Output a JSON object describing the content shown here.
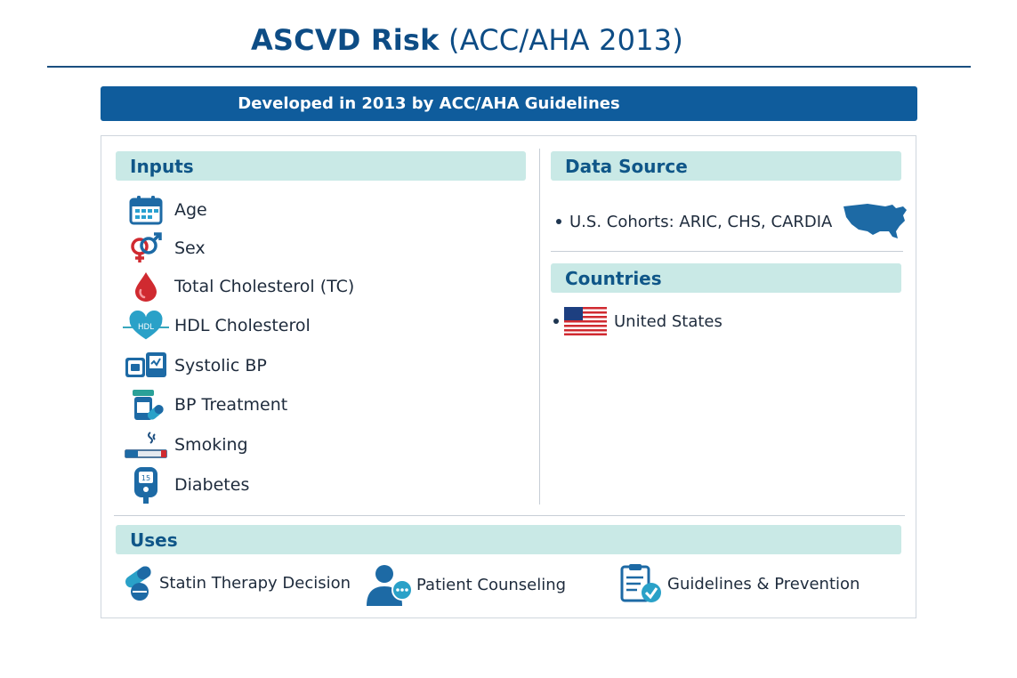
{
  "title": {
    "bold": "ASCVD Risk",
    "light": "(ACC/AHA 2013)"
  },
  "banner": "Developed in 2013 by ACC/AHA Guidelines",
  "inputs": {
    "heading": "Inputs",
    "items": [
      {
        "label": "Age",
        "icon": "calendar-icon"
      },
      {
        "label": "Sex",
        "icon": "gender-icon"
      },
      {
        "label": "Total Cholesterol (TC)",
        "icon": "blood-drop-icon"
      },
      {
        "label": "HDL Cholesterol",
        "icon": "heart-hdl-icon",
        "icon_text": "HDL"
      },
      {
        "label": "Systolic BP",
        "icon": "bp-monitor-icon"
      },
      {
        "label": "BP Treatment",
        "icon": "pill-bottle-icon"
      },
      {
        "label": "Smoking",
        "icon": "cigarette-icon"
      },
      {
        "label": "Diabetes",
        "icon": "glucose-meter-icon",
        "icon_text": "15"
      }
    ]
  },
  "data_source": {
    "heading": "Data Source",
    "items": [
      {
        "label": "U.S. Cohorts: ARIC, CHS, CARDIA",
        "icon": "usa-map-icon"
      }
    ]
  },
  "countries": {
    "heading": "Countries",
    "items": [
      {
        "label": "United States",
        "icon": "us-flag-icon"
      }
    ]
  },
  "uses": {
    "heading": "Uses",
    "items": [
      {
        "label": "Statin Therapy Decision",
        "icon": "pills-icon"
      },
      {
        "label": "Patient Counseling",
        "icon": "counseling-icon"
      },
      {
        "label": "Guidelines & Prevention",
        "icon": "clipboard-check-icon"
      }
    ]
  },
  "colors": {
    "title": "#0d4c85",
    "banner": "#0f5c9c",
    "section_header_bg": "#c9e9e6",
    "section_header_text": "#0f5688",
    "icon_blue": "#1d6aa5",
    "icon_teal": "#2aa198",
    "icon_red": "#d02a30"
  }
}
